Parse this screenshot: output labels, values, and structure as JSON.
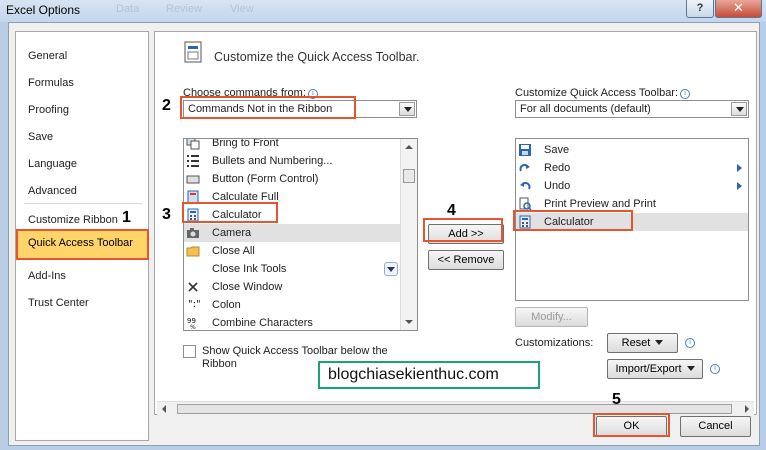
{
  "window": {
    "title": "Excel Options",
    "ghost_tabs": [
      "Data",
      "Review",
      "View"
    ],
    "help_label": "?",
    "close_label": "✕"
  },
  "nav": {
    "items": [
      "General",
      "Formulas",
      "Proofing",
      "Save",
      "Language",
      "Advanced",
      "Customize Ribbon",
      "Quick Access Toolbar",
      "Add-Ins",
      "Trust Center"
    ],
    "selected": "Quick Access Toolbar"
  },
  "main": {
    "heading": "Customize the Quick Access Toolbar.",
    "choose_label": "Choose commands from:",
    "choose_value": "Commands Not in the Ribbon",
    "customize_label": "Customize Quick Access Toolbar:",
    "customize_value": "For all documents (default)",
    "commands": [
      {
        "label": "Bring to Front",
        "icon": "bring-front-icon"
      },
      {
        "label": "Bullets and Numbering...",
        "icon": "bullets-icon"
      },
      {
        "label": "Button (Form Control)",
        "icon": "button-control-icon"
      },
      {
        "label": "Calculate Full",
        "icon": "calculate-full-icon"
      },
      {
        "label": "Calculator",
        "icon": "calculator-icon"
      },
      {
        "label": "Camera",
        "icon": "camera-icon"
      },
      {
        "label": "Close All",
        "icon": "folder-icon"
      },
      {
        "label": "Close Ink Tools",
        "icon": ""
      },
      {
        "label": "Close Window",
        "icon": "close-window-icon"
      },
      {
        "label": "Colon",
        "icon": "colon-icon"
      },
      {
        "label": "Combine Characters",
        "icon": "combine-characters-icon"
      }
    ],
    "qat_items": [
      {
        "label": "Save",
        "icon": "save-icon"
      },
      {
        "label": "Redo",
        "icon": "redo-icon"
      },
      {
        "label": "Undo",
        "icon": "undo-icon"
      },
      {
        "label": "Print Preview and Print",
        "icon": "print-preview-icon"
      },
      {
        "label": "Calculator",
        "icon": "calculator-icon"
      }
    ],
    "add_label": "Add >>",
    "remove_label": "<< Remove",
    "modify_label": "Modify...",
    "customizations_label": "Customizations:",
    "reset_label": "Reset",
    "import_export_label": "Import/Export",
    "show_below_label": "Show Quick Access Toolbar below the Ribbon",
    "show_below_checked": false
  },
  "footer": {
    "ok_label": "OK",
    "cancel_label": "Cancel"
  },
  "annotations": {
    "step_numbers": [
      "1",
      "2",
      "3",
      "4",
      "5"
    ],
    "watermark": "blogchiasekienthuc.com",
    "highlight_color": "#e8552d",
    "watermark_border_color": "#1aa37a"
  }
}
